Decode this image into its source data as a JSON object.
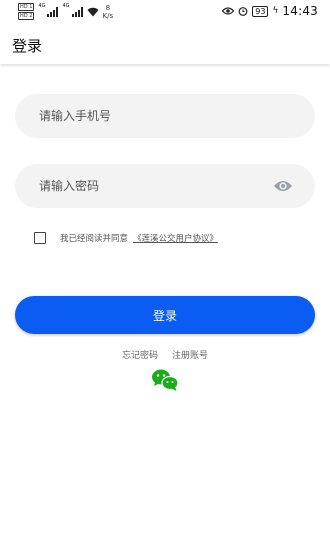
{
  "status_bar": {
    "sim1": "HD 1",
    "sim2": "HD 2",
    "network1": "4G",
    "network2": "4G",
    "speed_value": "8",
    "speed_unit": "K/s",
    "battery": "93",
    "time": "14:43"
  },
  "header": {
    "title": "登录"
  },
  "phone_input": {
    "placeholder": "请输入手机号",
    "value": ""
  },
  "password_input": {
    "placeholder": "请输入密码",
    "value": ""
  },
  "agreement": {
    "checked": false,
    "text": "我已经阅读并同意",
    "link": "《莲溪公交用户协议》"
  },
  "login_button": {
    "label": "登录"
  },
  "links": {
    "forgot": "忘记密码",
    "register": "注册账号"
  },
  "icons": {
    "wechat": "wechat-icon",
    "eye": "eye-icon",
    "wechat_color": "#1aad19"
  },
  "colors": {
    "primary": "#0b5cf2",
    "field_bg": "#f3f3f3"
  }
}
